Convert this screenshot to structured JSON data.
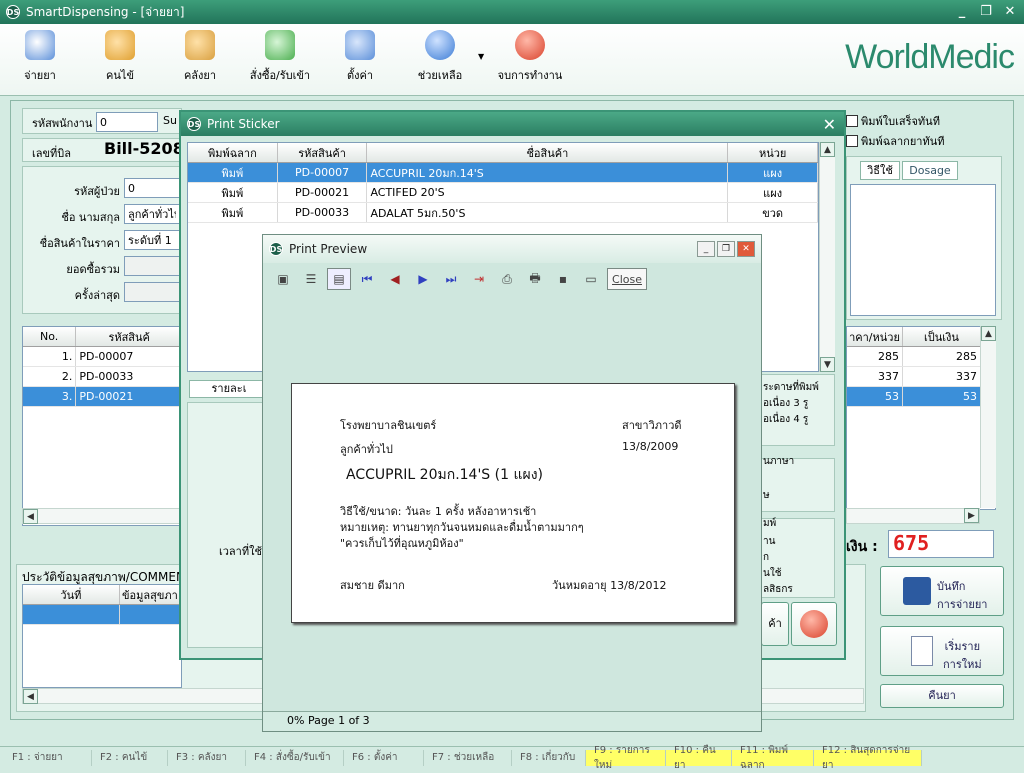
{
  "app": {
    "title": "SmartDispensing - [จ่ายยา]",
    "brand": "WorldMedic",
    "ds_badge": "DS"
  },
  "window_buttons": {
    "minimize": "_",
    "restore": "❐",
    "close": "✕"
  },
  "toolbar": [
    {
      "label": "จ่ายยา",
      "icon": "dispense-icon",
      "color": "#5b8fd9"
    },
    {
      "label": "คนไข้",
      "icon": "patients-icon",
      "color": "#e0a030"
    },
    {
      "label": "คลังยา",
      "icon": "warehouse-icon",
      "color": "#d9a040"
    },
    {
      "label": "สั่งซื้อ/รับเข้า",
      "icon": "order-icon",
      "color": "#4caf50"
    },
    {
      "label": "ตั้งค่า",
      "icon": "settings-icon",
      "color": "#5b8fd9"
    },
    {
      "label": "ช่วยเหลือ",
      "icon": "help-icon",
      "color": "#3a7bd5"
    },
    {
      "label": "จบการทำงาน",
      "icon": "power-icon",
      "color": "#d9412b"
    }
  ],
  "form": {
    "employee_label": "รหัสพนักงาน",
    "employee_value": "0",
    "employee_suffix": "Su",
    "bill_label": "เลขที่บิล",
    "bill_value": "Bill-5208",
    "patient_id_label": "รหัสผู้ป่วย",
    "patient_id_value": "0",
    "name_label": "ชื่อ นามสกุล",
    "name_value": "ลูกค้าทั่วไป",
    "price_label": "ชื่อสินค้าในราคา",
    "price_value": "ระดับที่ 1",
    "total_label": "ยอดซื้อรวม",
    "last_label": "ครั้งล่าสุด"
  },
  "checkboxes": [
    {
      "label": "พิมพ์ใบเสร็จทันที",
      "checked": false
    },
    {
      "label": "พิมพ์ฉลากยาทันที",
      "checked": false
    }
  ],
  "right_tabs": [
    "วิธีใช้",
    "Dosage"
  ],
  "main_grid": {
    "headers": [
      "No.",
      "รหัสสินค้"
    ],
    "rows": [
      {
        "no": "1.",
        "code": "PD-00007",
        "price": "285",
        "amount": "285"
      },
      {
        "no": "2.",
        "code": "PD-00033",
        "price": "337",
        "amount": "337"
      },
      {
        "no": "3.",
        "code": "PD-00021",
        "price": "53",
        "amount": "53"
      }
    ],
    "price_header": "าคา/หน่วย",
    "amount_header": "เป็นเงิน"
  },
  "total": {
    "label": "เงิน :",
    "value": "675"
  },
  "history": {
    "title": "ประวัติข้อมูลสุขภาพ/COMMEN",
    "headers": [
      "วันที่",
      "ข้อมูลสุขภา"
    ]
  },
  "time_label": "เวลาที่ใช้",
  "side_fragments": {
    "print_group": "ระดาษที่พิมพ์",
    "opt1": "อเนื่อง 3 รู",
    "opt2": "อเนื่อง 4 รู",
    "lang": "นภาษา",
    "lang_opt": "ษ",
    "print_opts": "มพ์",
    "p1": "าน",
    "p2": "ก",
    "p3": "นใช้",
    "p4": "ลสิธกร",
    "product_btn": "ค้า"
  },
  "buttons": {
    "save": "บันทึก\nการจ่ายยา",
    "new": "เริ่มราย\nการใหม่",
    "return": "คืนยา"
  },
  "sticker": {
    "title": "Print Sticker",
    "headers": [
      "พิมพ์ฉลาก",
      "รหัสสินค้า",
      "ชื่อสินค้า",
      "หน่วย"
    ],
    "rows": [
      {
        "print": "พิมพ์",
        "code": "PD-00007",
        "name": "ACCUPRIL 20มก.14'S",
        "unit": "แผง"
      },
      {
        "print": "พิมพ์",
        "code": "PD-00021",
        "name": "ACTIFED 20'S",
        "unit": "แผง"
      },
      {
        "print": "พิมพ์",
        "code": "PD-00033",
        "name": "ADALAT 5มก.50'S",
        "unit": "ขวด"
      }
    ],
    "detail_tab": "รายละเ"
  },
  "preview": {
    "title": "Print Preview",
    "close_label": "Close",
    "status": "0% Page 1 of 3",
    "label": {
      "hospital": "โรงพยาบาลชินเขตร์",
      "branch": "สาขาวิภาวดี",
      "customer": "ลูกค้าทั่วไป",
      "date": "13/8/2009",
      "drug": "ACCUPRIL 20มก.14'S (1 แผง)",
      "usage": "วิธีใช้/ขนาด: วันละ 1 ครั้ง หลังอาหารเช้า",
      "note": "หมายเหตุ: ทานยาทุกวันจนหมดและดื่มน้ำตามมากๆ",
      "storage": "\"ควรเก็บไว้ที่อุณหภูมิห้อง\"",
      "pharmacist": "สมชาย ดีมาก",
      "expiry": "วันหมดอายุ 13/8/2012"
    }
  },
  "fkeys": [
    {
      "label": "F1 : จ่ายยา",
      "hi": false
    },
    {
      "label": "F2 : คนไข้",
      "hi": false
    },
    {
      "label": "F3 : คลังยา",
      "hi": false
    },
    {
      "label": "F4 : สั่งซื้อ/รับเข้า",
      "hi": false
    },
    {
      "label": "F6 : ตั้งค่า",
      "hi": false
    },
    {
      "label": "F7 : ช่วยเหลือ",
      "hi": false
    },
    {
      "label": "F8 : เกี่ยวกับ",
      "hi": false
    },
    {
      "label": "F9 : รายการใหม่",
      "hi": true
    },
    {
      "label": "F10 : คืนยา",
      "hi": true
    },
    {
      "label": "F11 : พิมพ์ฉลาก",
      "hi": true
    },
    {
      "label": "F12 : สินสุดการจ่ายยา",
      "hi": true
    }
  ]
}
